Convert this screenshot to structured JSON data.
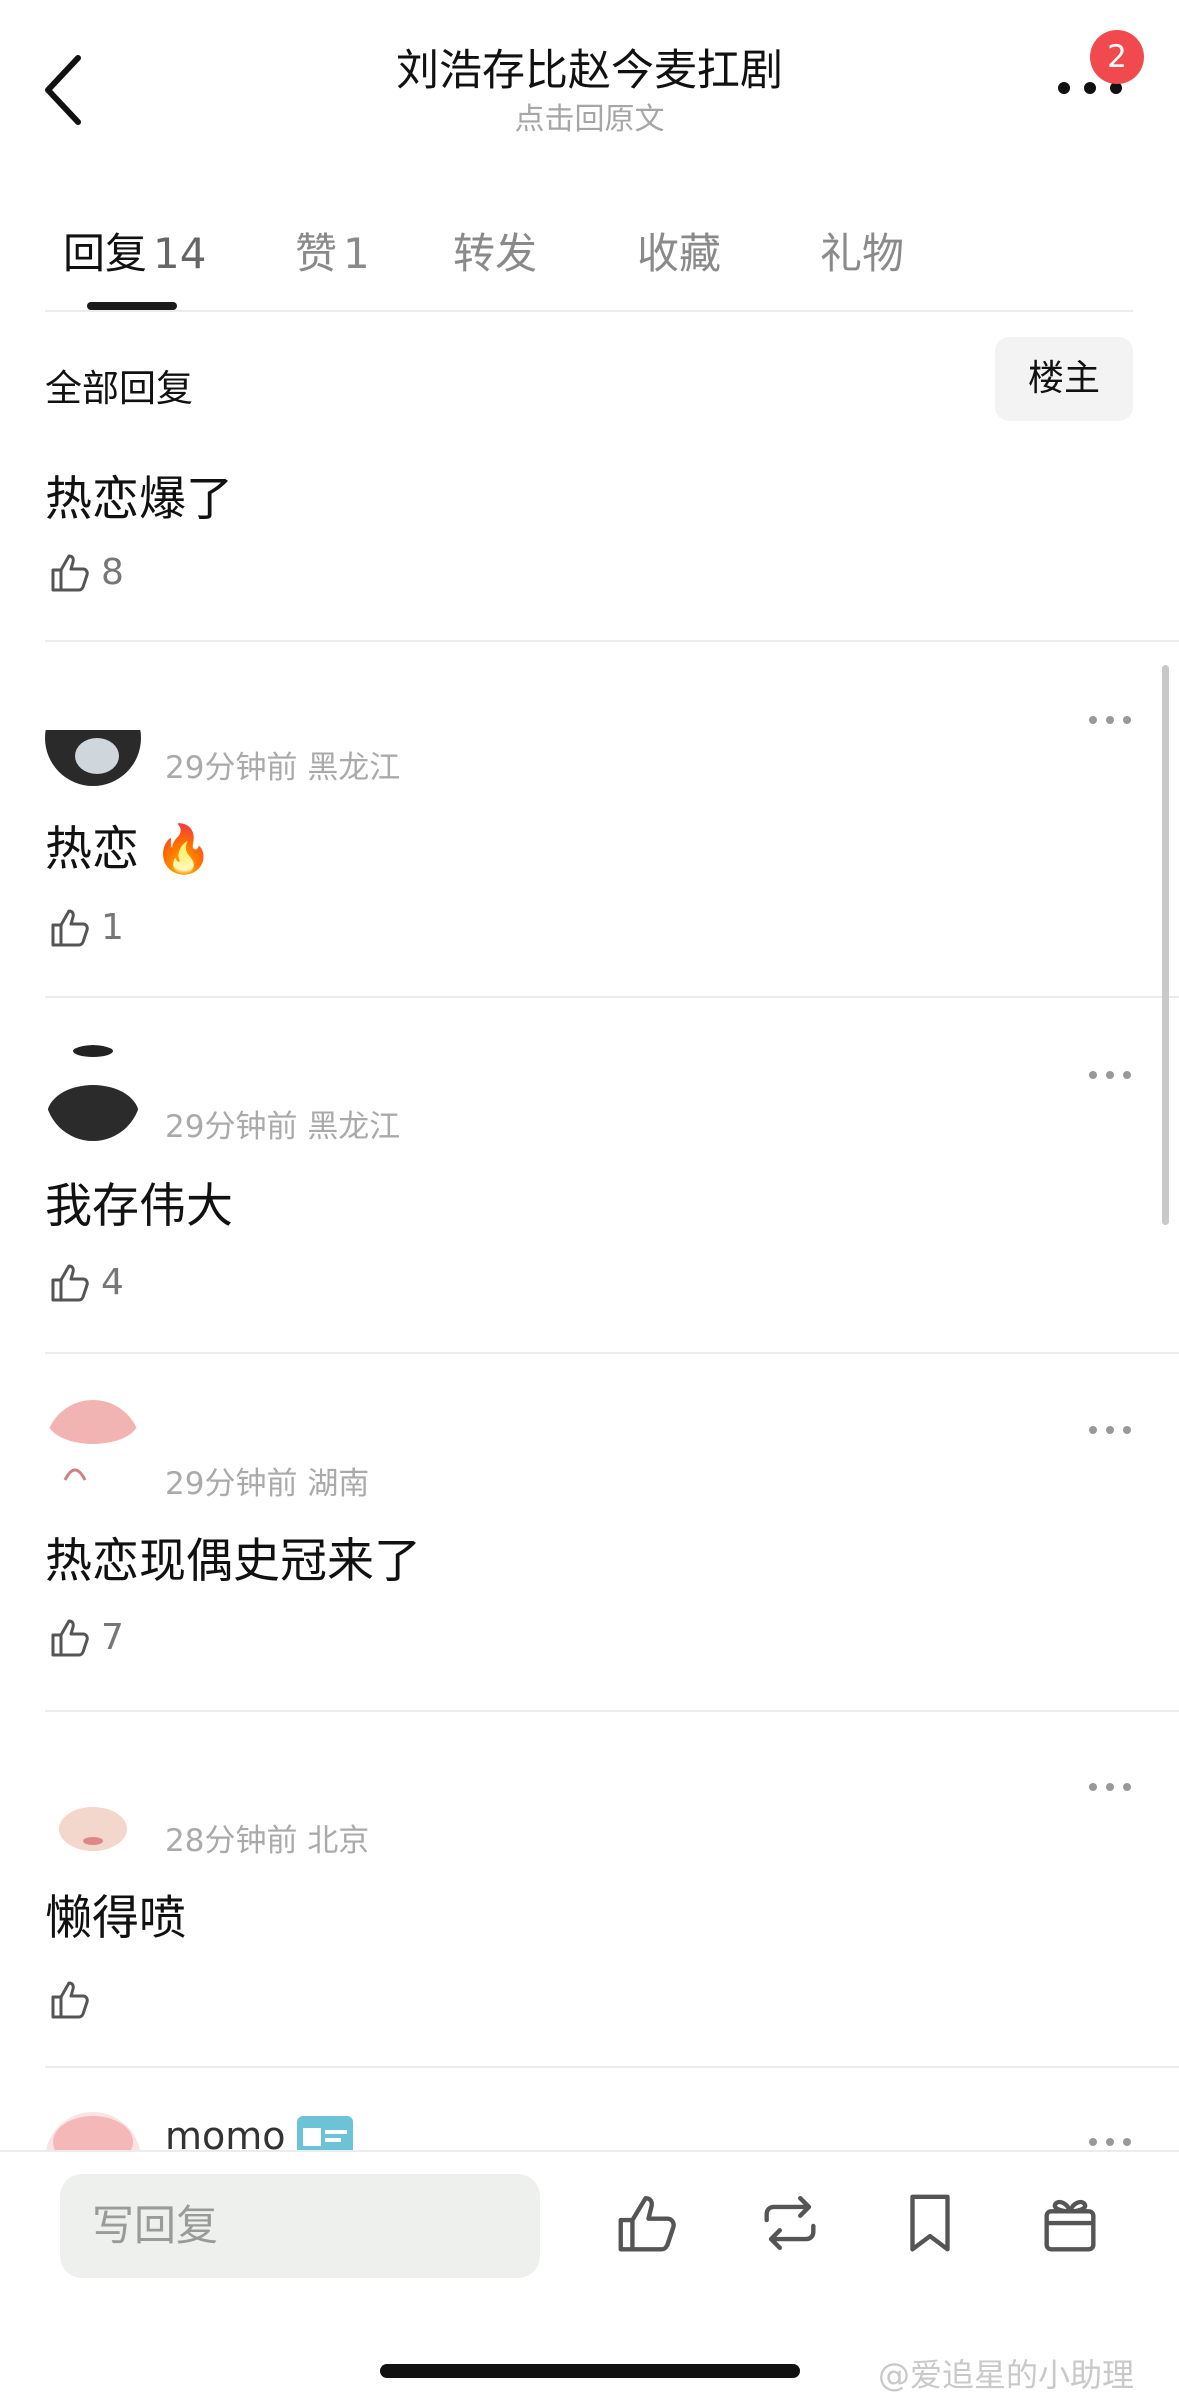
{
  "header": {
    "title": "刘浩存比赵今麦扛剧",
    "subtitle": "点击回原文",
    "badge_count": "2"
  },
  "tabs": [
    {
      "label": "回复",
      "count": "14"
    },
    {
      "label": "赞",
      "count": "1"
    },
    {
      "label": "转发",
      "count": ""
    },
    {
      "label": "收藏",
      "count": ""
    },
    {
      "label": "礼物",
      "count": ""
    }
  ],
  "filter": {
    "label": "全部回复",
    "button": "楼主"
  },
  "comments": [
    {
      "text": "热恋爆了",
      "likes": "8"
    },
    {
      "time": "29分钟前",
      "location": "黑龙江",
      "text": "热恋 🔥",
      "likes": "1"
    },
    {
      "time": "29分钟前",
      "location": "黑龙江",
      "text": "我存伟大",
      "likes": "4"
    },
    {
      "time": "29分钟前",
      "location": "湖南",
      "text": "热恋现偶史冠来了",
      "likes": "7"
    },
    {
      "time": "28分钟前",
      "location": "北京",
      "text": "懒得喷",
      "likes": ""
    },
    {
      "name": "momo"
    }
  ],
  "bottom": {
    "reply_placeholder": "写回复"
  },
  "watermark": "@爱追星的小助理",
  "colors": {
    "badge": "#f04a4f",
    "divider": "#ececec",
    "muted": "#aaaaaa"
  }
}
